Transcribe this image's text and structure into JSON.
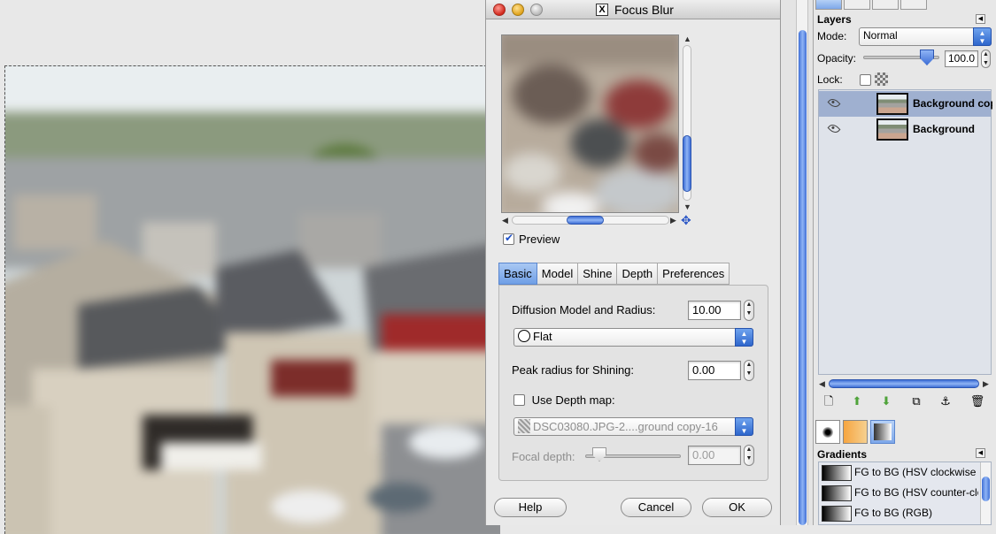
{
  "dialog": {
    "title": "Focus Blur",
    "preview_label": "Preview",
    "tabs": [
      "Basic",
      "Model",
      "Shine",
      "Depth",
      "Preferences"
    ],
    "diffusion_label": "Diffusion Model and Radius:",
    "diffusion_value": "10.00",
    "model_option": "Flat",
    "peak_label": "Peak radius for Shining:",
    "peak_value": "0.00",
    "use_depth_label": "Use Depth map:",
    "depth_map_value": "DSC03080.JPG-2....ground copy-16",
    "focal_label": "Focal depth:",
    "focal_value": "0.00",
    "help_label": "Help",
    "cancel_label": "Cancel",
    "ok_label": "OK"
  },
  "layers_panel": {
    "title": "Layers",
    "mode_label": "Mode:",
    "mode_value": "Normal",
    "opacity_label": "Opacity:",
    "opacity_value": "100.0",
    "lock_label": "Lock:",
    "layers": [
      {
        "name": "Background copy",
        "selected": true
      },
      {
        "name": "Background",
        "selected": false
      }
    ]
  },
  "gradients_panel": {
    "title": "Gradients",
    "items": [
      "FG to BG (HSV clockwise hue)",
      "FG to BG (HSV counter-clockwise)",
      "FG to BG (RGB)"
    ]
  },
  "colors": {
    "accent": "#3f6fd6",
    "tab_active": "#6f9fe6",
    "layer_selected": "#9fb0d0"
  }
}
